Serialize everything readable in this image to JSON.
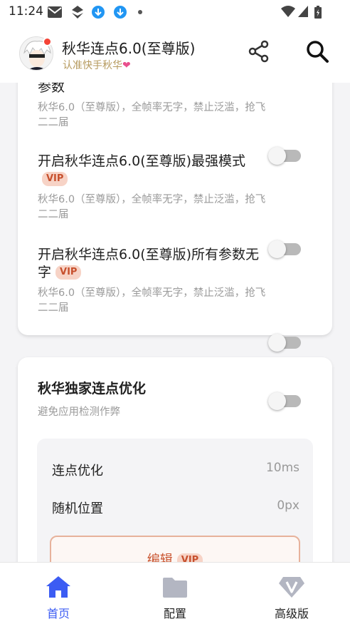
{
  "status_bar": {
    "time": "11:24"
  },
  "header": {
    "title": "秋华连点6.0(至尊版)",
    "subtitle": "认准快手秋华",
    "subtitle_heart": "❤"
  },
  "settings_card": {
    "items": [
      {
        "title": "参数",
        "vip": "",
        "description": "秋华6.0（至尊版），全帧率无字，禁止泛滥，抢飞二二届",
        "enabled": false
      },
      {
        "title": "开启秋华连点6.0(至尊版)最强模式",
        "vip": "VIP",
        "description": "秋华6.0（至尊版），全帧率无字，禁止泛滥，抢飞二二届",
        "enabled": false
      },
      {
        "title": "开启秋华连点6.0(至尊版)所有参数无字",
        "vip": "VIP",
        "description": "秋华6.0（至尊版），全帧率无字，禁止泛滥，抢飞二二届",
        "enabled": false
      }
    ]
  },
  "optimize_card": {
    "title": "秋华独家连点优化",
    "description": "避免应用检测作弊",
    "enabled": false,
    "params": [
      {
        "label": "连点优化",
        "value": "10ms"
      },
      {
        "label": "随机位置",
        "value": "0px"
      }
    ],
    "edit_label": "编辑",
    "edit_vip": "VIP"
  },
  "bottom_nav": {
    "items": [
      {
        "label": "首页",
        "icon": "home-icon",
        "active": true
      },
      {
        "label": "配置",
        "icon": "folder-icon",
        "active": false
      },
      {
        "label": "高级版",
        "icon": "vip-diamond-icon",
        "active": false
      }
    ]
  },
  "colors": {
    "accent": "#3c5cf3",
    "vip_bg": "#f7d3c6",
    "vip_text": "#c7502d",
    "subtitle": "#b69a5e"
  }
}
